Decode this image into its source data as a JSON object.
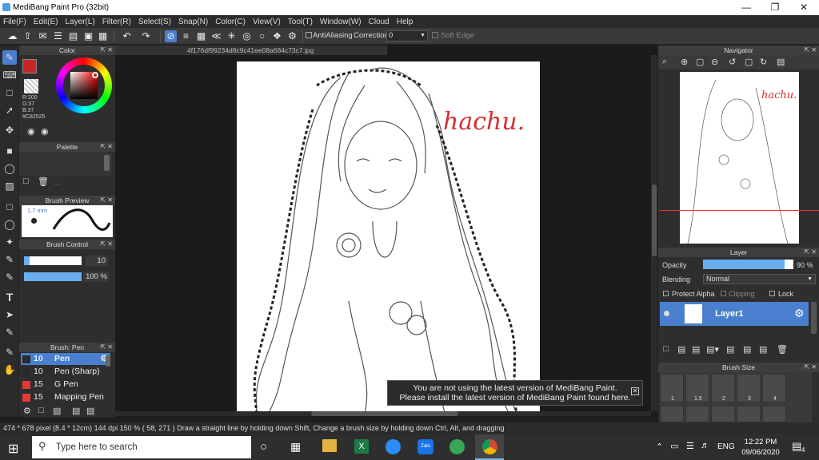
{
  "app": {
    "title": "MediBang Paint Pro (32bit)"
  },
  "menu": [
    "File(F)",
    "Edit(E)",
    "Layer(L)",
    "Filter(R)",
    "Select(S)",
    "Snap(N)",
    "Color(C)",
    "View(V)",
    "Tool(T)",
    "Window(W)",
    "Cloud",
    "Help"
  ],
  "toolbar": {
    "antialiasing": "AntiAliasing",
    "correction_label": "Correction",
    "correction_value": "0",
    "soft_edge": "Soft Edge"
  },
  "document": {
    "filename": "4f176df99234d8c9c41ee08a684c73c7.jpg"
  },
  "canvas": {
    "signature": "hachu."
  },
  "color_panel": {
    "title": "Color",
    "r": "R:200",
    "g": "G:37",
    "b": "B:37",
    "hex": "#C82525",
    "fg_color": "#C82525"
  },
  "palette_panel": {
    "title": "Palette",
    "dots": "..."
  },
  "brush_preview": {
    "title": "Brush Preview",
    "size": "1.7 mm"
  },
  "brush_control": {
    "title": "Brush Control",
    "size_value": "10",
    "opacity_value": "100 %",
    "size_fraction": 0.1,
    "opacity_fraction": 1.0
  },
  "brush_list": {
    "title": "Brush: Pen",
    "items": [
      {
        "size": "10",
        "name": "Pen",
        "color": "#2a2a2a",
        "active": true
      },
      {
        "size": "10",
        "name": "Pen (Sharp)",
        "color": "#2a2a2a",
        "active": false
      },
      {
        "size": "15",
        "name": "G Pen",
        "color": "#e53935",
        "active": false
      },
      {
        "size": "15",
        "name": "Mapping Pen",
        "color": "#e53935",
        "active": false
      }
    ]
  },
  "navigator": {
    "title": "Navigator"
  },
  "layer_panel": {
    "title": "Layer",
    "opacity_label": "Opacity",
    "opacity_value": "90 %",
    "opacity_fraction": 0.9,
    "blending_label": "Blending",
    "blending_value": "Normal",
    "protect_alpha": "Protect Alpha",
    "clipping": "Clipping",
    "lock": "Lock",
    "layer_name": "Layer1"
  },
  "brush_size_panel": {
    "title": "Brush Size",
    "sizes": [
      "1",
      "1.5",
      "2",
      "3",
      "4"
    ]
  },
  "notice": {
    "line1": "You are not using the latest version of MediBang Paint.",
    "line2": "Please install the latest version of MediBang Paint found here."
  },
  "status": {
    "size": "474 * 678 pixel",
    "phys": "(8.4 * 12cm)",
    "dpi": "144 dpi",
    "zoom": "150 %",
    "coords": "( 58, 271 )",
    "hint": "Draw a straight line by holding down Shift, Change a brush size by holding down Ctrl, Alt, and dragging"
  },
  "taskbar": {
    "search_placeholder": "Type here to search",
    "lang": "ENG",
    "time": "12:22 PM",
    "date": "09/06/2020",
    "notif_count": "4"
  }
}
